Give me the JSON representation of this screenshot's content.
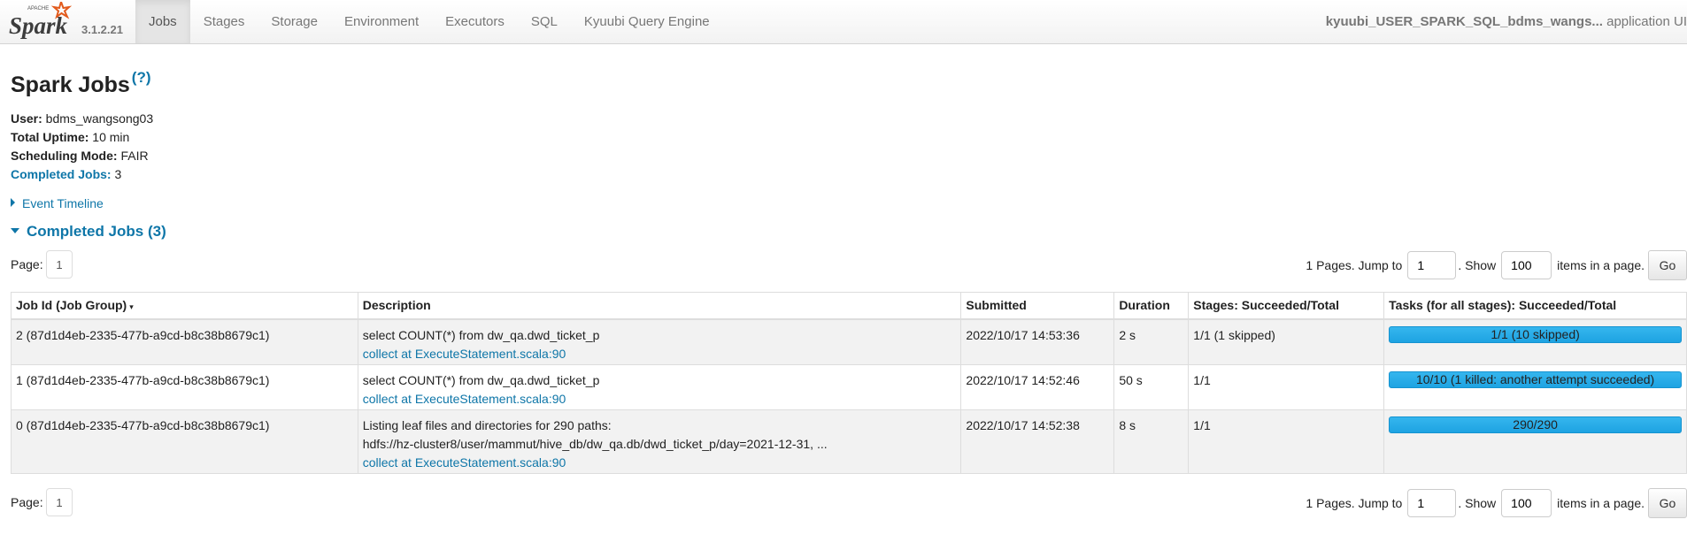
{
  "nav": {
    "logo_text": "Spark",
    "logo_small": "APACHE",
    "version": "3.1.2.21",
    "tabs": [
      {
        "label": "Jobs"
      },
      {
        "label": "Stages"
      },
      {
        "label": "Storage"
      },
      {
        "label": "Environment"
      },
      {
        "label": "Executors"
      },
      {
        "label": "SQL"
      },
      {
        "label": "Kyuubi Query Engine"
      }
    ],
    "app_name": "kyuubi_USER_SPARK_SQL_bdms_wangs...",
    "app_suffix": " application UI"
  },
  "header": {
    "title": "Spark Jobs",
    "help": "(?)",
    "user_label": "User:",
    "user_value": " bdms_wangsong03",
    "uptime_label": "Total Uptime:",
    "uptime_value": " 10 min",
    "mode_label": "Scheduling Mode:",
    "mode_value": " FAIR",
    "completed_label": "Completed Jobs:",
    "completed_value": " 3",
    "timeline": "Event Timeline",
    "section": "Completed Jobs (3)"
  },
  "paging": {
    "page_label": "Page:",
    "current_page": "1",
    "pages_text": "1 Pages. Jump to",
    "jump_value": "1",
    "show_text": ". Show",
    "size_value": "100",
    "items_text": "items in a page.",
    "go": "Go"
  },
  "table": {
    "columns": [
      "Job Id (Job Group)",
      "Description",
      "Submitted",
      "Duration",
      "Stages: Succeeded/Total",
      "Tasks (for all stages): Succeeded/Total"
    ],
    "sort_indicator": "▾",
    "rows": [
      {
        "job": "2 (87d1d4eb-2335-477b-a9cd-b8c38b8679c1)",
        "desc": "select COUNT(*) from dw_qa.dwd_ticket_p",
        "desc2": "",
        "link": "collect at ExecuteStatement.scala:90",
        "submitted": "2022/10/17 14:53:36",
        "duration": "2 s",
        "stages": "1/1 (1 skipped)",
        "tasks": "1/1 (10 skipped)",
        "tasks_fraction": 1.0
      },
      {
        "job": "1 (87d1d4eb-2335-477b-a9cd-b8c38b8679c1)",
        "desc": "select COUNT(*) from dw_qa.dwd_ticket_p",
        "desc2": "",
        "link": "collect at ExecuteStatement.scala:90",
        "submitted": "2022/10/17 14:52:46",
        "duration": "50 s",
        "stages": "1/1",
        "tasks": "10/10 (1 killed: another attempt succeeded)",
        "tasks_fraction": 1.0
      },
      {
        "job": "0 (87d1d4eb-2335-477b-a9cd-b8c38b8679c1)",
        "desc": "Listing leaf files and directories for 290 paths:",
        "desc2": "hdfs://hz-cluster8/user/mammut/hive_db/dw_qa.db/dwd_ticket_p/day=2021-12-31, ...",
        "link": "collect at ExecuteStatement.scala:90",
        "submitted": "2022/10/17 14:52:38",
        "duration": "8 s",
        "stages": "1/1",
        "tasks": "290/290",
        "tasks_fraction": 1.0
      }
    ]
  },
  "colors": {
    "link": "#0e76a8",
    "bar": "#1ea3e2"
  }
}
